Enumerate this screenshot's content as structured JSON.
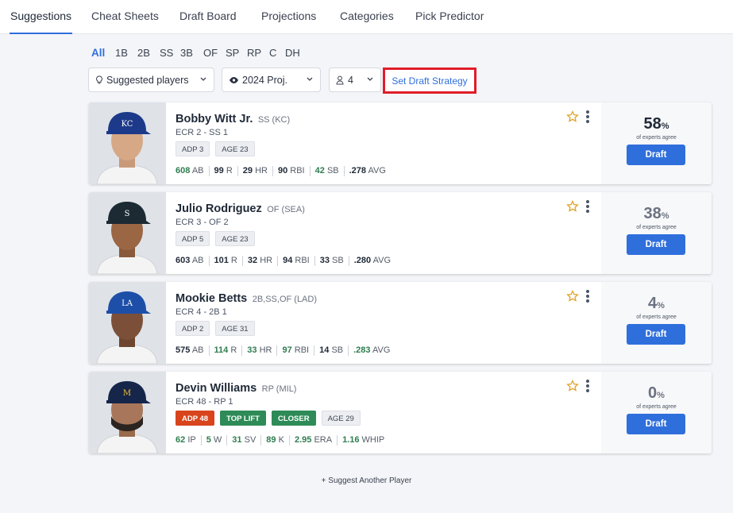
{
  "tabs": [
    "Suggestions",
    "Cheat Sheets",
    "Draft Board",
    "Projections",
    "Categories",
    "Pick Predictor"
  ],
  "positions": [
    "All",
    "1B",
    "2B",
    "SS",
    "3B",
    "OF",
    "SP",
    "RP",
    "C",
    "DH"
  ],
  "controls": {
    "suggested": "Suggested players",
    "proj": "2024 Proj.",
    "count": "4",
    "strategy": "Set Draft Strategy"
  },
  "experts_label": "of experts agree",
  "draft_label": "Draft",
  "players": [
    {
      "name": "Bobby Witt Jr.",
      "pos": "SS (KC)",
      "ecr": "ECR 2 - SS 1",
      "badges": [
        "ADP 3",
        "AGE 23"
      ],
      "stats": [
        [
          "608",
          "AB"
        ],
        [
          "99",
          "R"
        ],
        [
          "29",
          "HR"
        ],
        [
          "90",
          "RBI"
        ],
        [
          "42",
          "SB"
        ],
        [
          ".278",
          "AVG"
        ]
      ],
      "pct": "58",
      "team": "KC",
      "cap_color": "#1d3a8a"
    },
    {
      "name": "Julio Rodriguez",
      "pos": "OF (SEA)",
      "ecr": "ECR 3 - OF 2",
      "badges": [
        "ADP 5",
        "AGE 23"
      ],
      "stats": [
        [
          "603",
          "AB"
        ],
        [
          "101",
          "R"
        ],
        [
          "32",
          "HR"
        ],
        [
          "94",
          "RBI"
        ],
        [
          "33",
          "SB"
        ],
        [
          ".280",
          "AVG"
        ]
      ],
      "pct": "38",
      "team": "S",
      "cap_color": "#1b2a33"
    },
    {
      "name": "Mookie Betts",
      "pos": "2B,SS,OF (LAD)",
      "ecr": "ECR 4 - 2B 1",
      "badges": [
        "ADP 2",
        "AGE 31"
      ],
      "stats": [
        [
          "575",
          "AB"
        ],
        [
          "114",
          "R"
        ],
        [
          "33",
          "HR"
        ],
        [
          "97",
          "RBI"
        ],
        [
          "14",
          "SB"
        ],
        [
          ".283",
          "AVG"
        ]
      ],
      "pct": "4",
      "team": "LA",
      "cap_color": "#1e4fa8"
    },
    {
      "name": "Devin Williams",
      "pos": "RP (MIL)",
      "ecr": "ECR 48 - RP 1",
      "badges": [
        "ADP 48",
        "TOP LIFT",
        "CLOSER",
        "AGE 29"
      ],
      "stats": [
        [
          "62",
          "IP"
        ],
        [
          "5",
          "W"
        ],
        [
          "31",
          "SV"
        ],
        [
          "89",
          "K"
        ],
        [
          "2.95",
          "ERA"
        ],
        [
          "1.16",
          "WHIP"
        ]
      ],
      "pct": "0",
      "team": "M",
      "cap_color": "#16254a"
    }
  ],
  "suggest_another": "+ Suggest Another Player",
  "colors": {
    "accent": "#2f6fdc",
    "highlight_border": "#e01d2a",
    "stat_green": "#2e7d4f",
    "badge_red": "#d8441c",
    "badge_green": "#2e8b57"
  }
}
